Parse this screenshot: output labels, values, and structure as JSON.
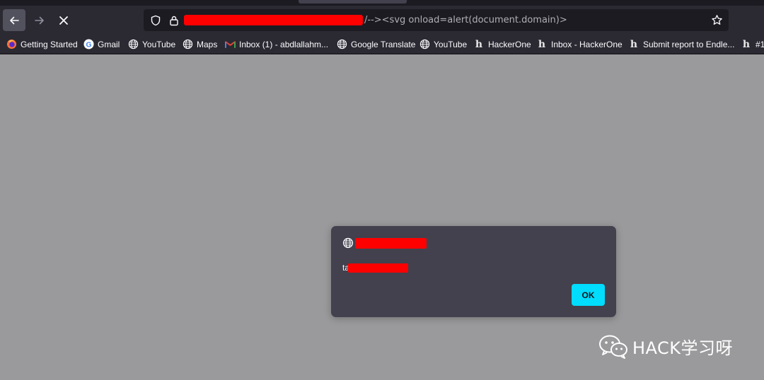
{
  "url_bar": {
    "url_visible_suffix": "/--><svg onload=alert(document.domain)>"
  },
  "bookmarks": [
    {
      "label": "Getting Started",
      "icon": "firefox-icon"
    },
    {
      "label": "Gmail",
      "icon": "google-icon"
    },
    {
      "label": "YouTube",
      "icon": "globe-icon"
    },
    {
      "label": "Maps",
      "icon": "globe-icon"
    },
    {
      "label": "Inbox (1) - abdlallahm...",
      "icon": "gmail-icon"
    },
    {
      "label": "Google Translate",
      "icon": "globe-icon"
    },
    {
      "label": "YouTube",
      "icon": "globe-icon"
    },
    {
      "label": "HackerOne",
      "icon": "hackerone-icon"
    },
    {
      "label": "Inbox - HackerOne",
      "icon": "hackerone-icon"
    },
    {
      "label": "Submit report to Endle...",
      "icon": "hackerone-icon"
    },
    {
      "label": "#1",
      "icon": "hackerone-icon"
    }
  ],
  "dialog": {
    "message_prefix": "ta",
    "ok_label": "OK"
  },
  "watermark": {
    "text": "HACK学习呀"
  },
  "colors": {
    "accent": "#00ddff",
    "redaction": "#ff0000",
    "page_background": "#9a999b",
    "chrome": "#2b2a33"
  }
}
